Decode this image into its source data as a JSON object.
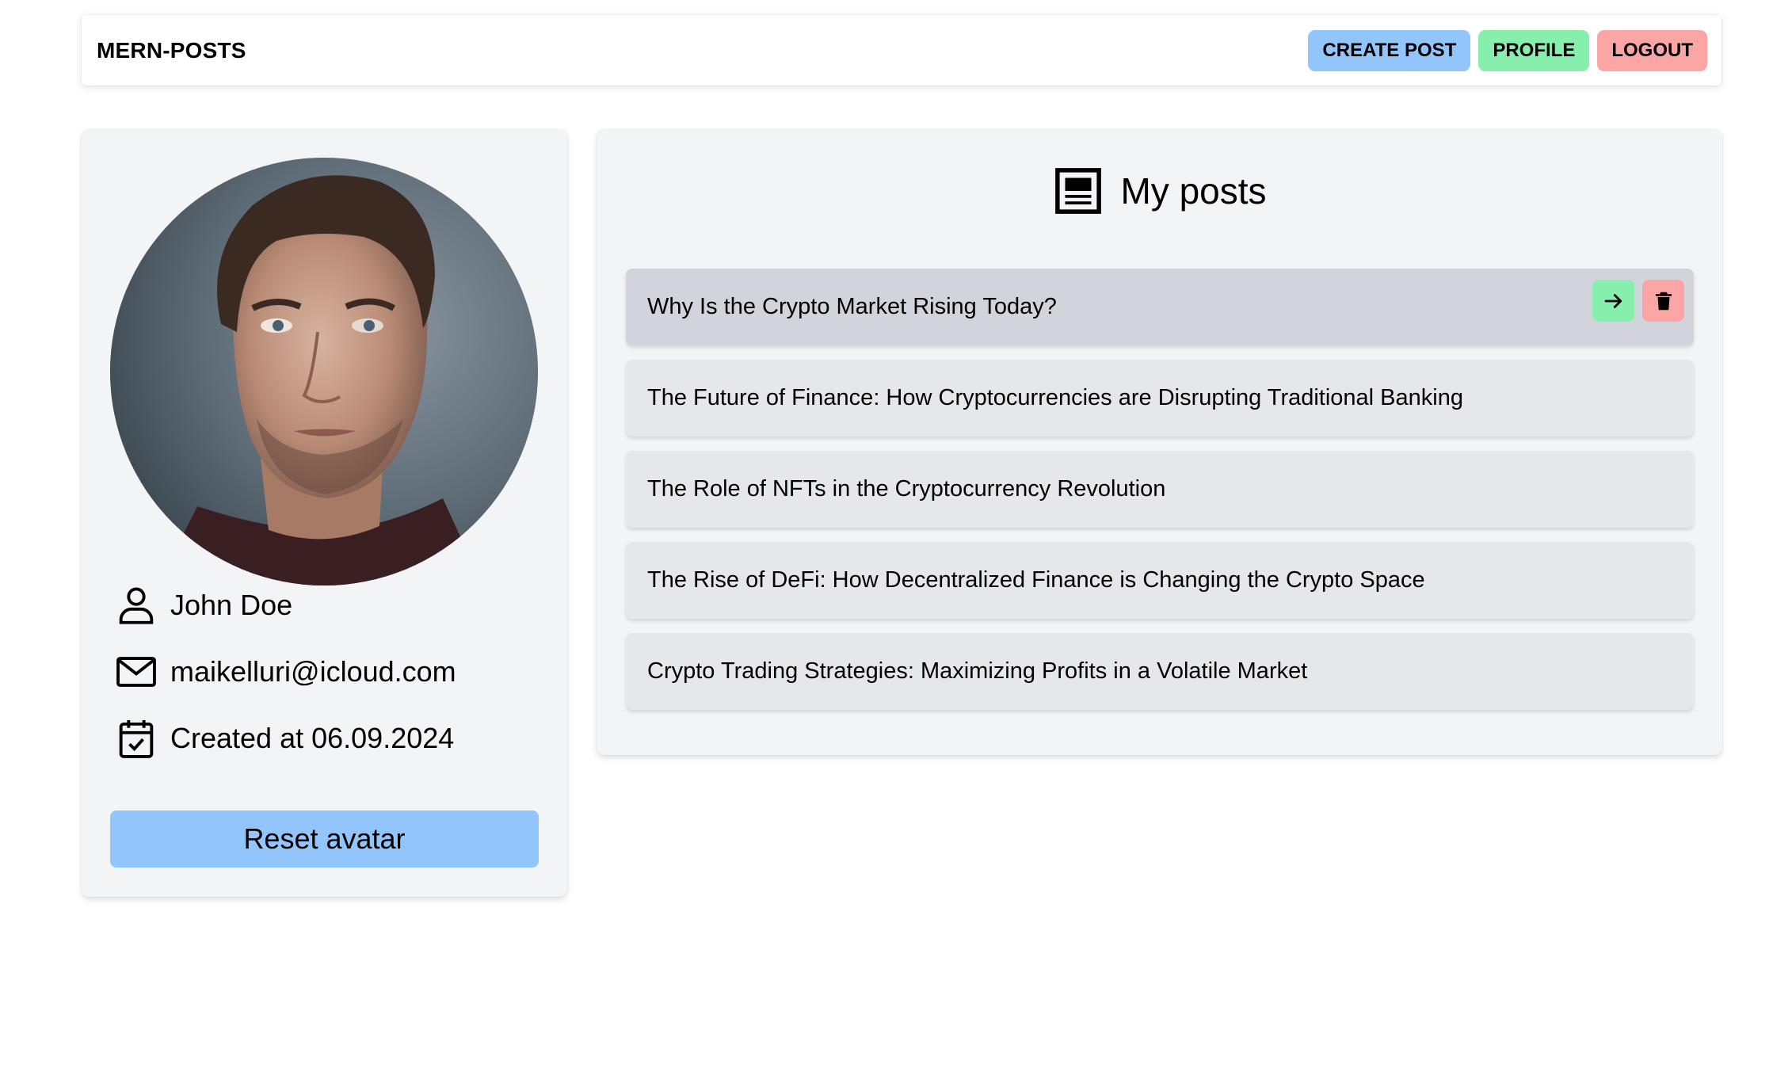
{
  "header": {
    "brand": "MERN-POSTS",
    "buttons": {
      "create_post": "CREATE POST",
      "profile": "PROFILE",
      "logout": "LOGOUT"
    }
  },
  "profile": {
    "name": "John Doe",
    "email": "maikelluri@icloud.com",
    "created": "Created at 06.09.2024",
    "reset_label": "Reset avatar",
    "icons": [
      "user-icon",
      "mail-icon",
      "calendar-check-icon"
    ]
  },
  "posts": {
    "title": "My posts",
    "items": [
      "Why Is the Crypto Market Rising Today?",
      "The Future of Finance: How Cryptocurrencies are Disrupting Traditional Banking",
      "The Role of NFTs in the Cryptocurrency Revolution",
      "The Rise of DeFi: How Decentralized Finance is Changing the Crypto Space",
      "Crypto Trading Strategies: Maximizing Profits in a Volatile Market"
    ],
    "active_index": 0
  },
  "colors": {
    "blue": "#93c5fd",
    "green": "#86efac",
    "red": "#fca5a5",
    "card_bg": "#f3f4f6",
    "item_bg": "#e5e7eb",
    "item_active_bg": "#d1d5db"
  }
}
